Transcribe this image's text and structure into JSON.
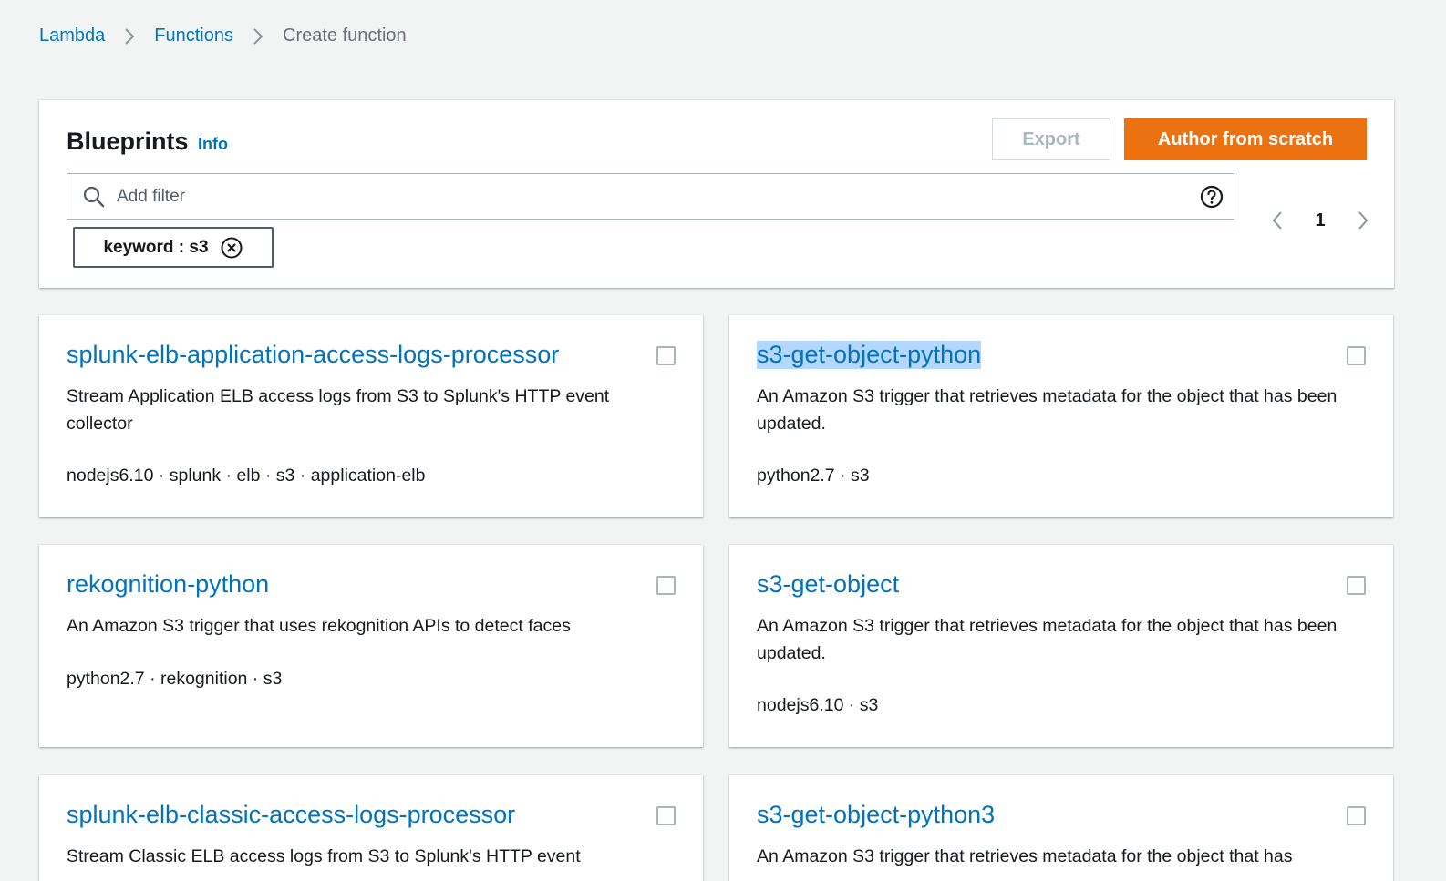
{
  "breadcrumb": {
    "items": [
      "Lambda",
      "Functions"
    ],
    "current": "Create function"
  },
  "blueprints": {
    "title": "Blueprints",
    "info_label": "Info",
    "export_label": "Export",
    "author_label": "Author from scratch",
    "filter": {
      "placeholder": "Add filter",
      "value": ""
    },
    "token_label": "keyword : s3",
    "pagination": {
      "page": "1"
    }
  },
  "cards": [
    {
      "title": "splunk-elb-application-access-logs-processor",
      "description": "Stream Application ELB access logs from S3 to Splunk's HTTP event collector",
      "tags": "nodejs6.10 · splunk · elb · s3 · application-elb",
      "checked": false
    },
    {
      "title": "s3-get-object-python",
      "description": "An Amazon S3 trigger that retrieves metadata for the object that has been updated.",
      "tags": "python2.7 · s3",
      "checked": false,
      "highlighted": true
    },
    {
      "title": "rekognition-python",
      "description": "An Amazon S3 trigger that uses rekognition APIs to detect faces",
      "tags": "python2.7 · rekognition · s3",
      "checked": false
    },
    {
      "title": "s3-get-object",
      "description": "An Amazon S3 trigger that retrieves metadata for the object that has been updated.",
      "tags": "nodejs6.10 · s3",
      "checked": false
    },
    {
      "title": "splunk-elb-classic-access-logs-processor",
      "description": "Stream Classic ELB access logs from S3 to Splunk's HTTP event",
      "tags": "",
      "checked": false
    },
    {
      "title": "s3-get-object-python3",
      "description": "An Amazon S3 trigger that retrieves metadata for the object that has",
      "tags": "",
      "checked": false
    }
  ],
  "colors": {
    "link": "#0073bb",
    "primary": "#ec7211",
    "background": "#f2f3f3",
    "highlight": "#b3d7ff"
  },
  "icons": [
    "chevron-right-icon",
    "search-icon",
    "help-icon",
    "dismiss-icon",
    "chevron-left-icon",
    "checkbox"
  ]
}
